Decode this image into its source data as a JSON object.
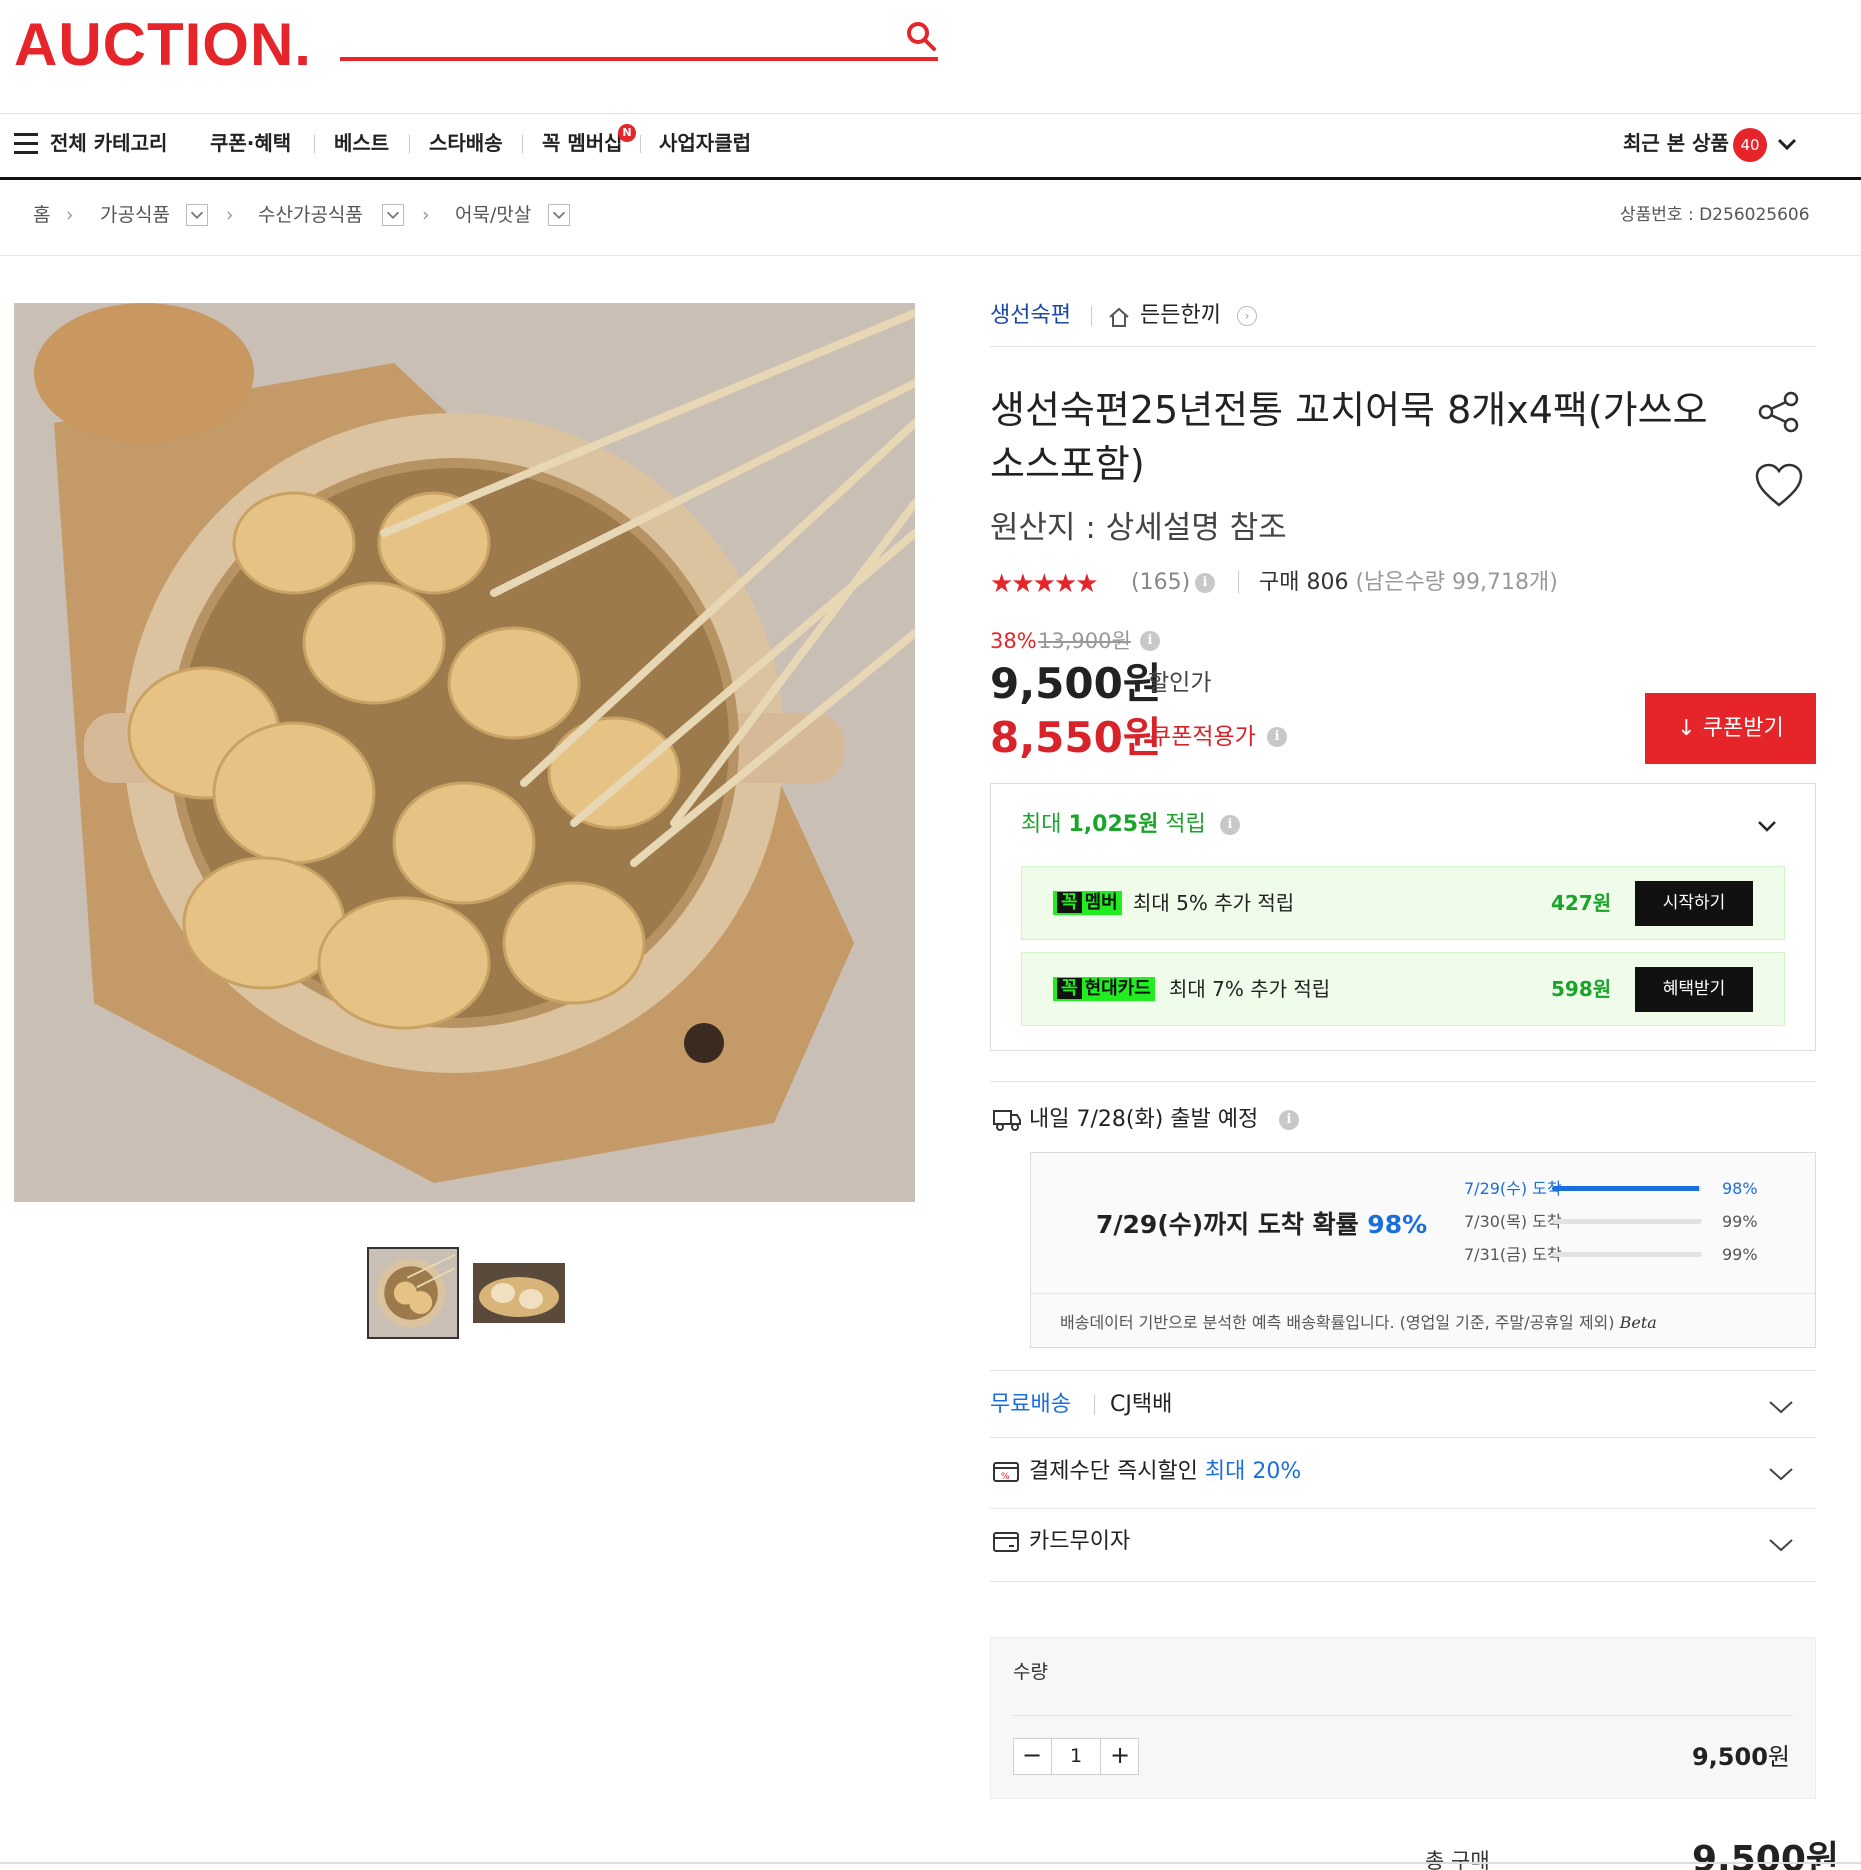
{
  "header": {
    "logo": "AUCTION.",
    "nav": {
      "all_categories": "전체 카테고리",
      "items": [
        "쿠폰·혜택",
        "베스트",
        "스타배송",
        "꼭 멤버십",
        "사업자클럽"
      ],
      "membership_badge": "N",
      "recent_label": "최근 본 상품",
      "recent_count": "40"
    }
  },
  "breadcrumb": {
    "items": [
      "홈",
      "가공식품",
      "수산가공식품",
      "어묵/맛살"
    ],
    "product_no": "상품번호 : D256025606"
  },
  "product": {
    "seller": "생선숙편",
    "store": "든든한끼",
    "title": "생선숙편25년전통 꼬치어묵 8개x4팩(가쓰오소스포함)",
    "origin": "원산지 : 상세설명 참조",
    "rating_stars": "★★★★★",
    "review_count": "(165)",
    "purchase_label": "구매 806",
    "remaining": "(남은수량 99,718개)",
    "discount_rate": "38%",
    "original_price": "13,900원",
    "sale_price": "9,500원",
    "sale_label": "할인가",
    "coupon_price": "8,550원",
    "coupon_label": "쿠폰적용가",
    "coupon_button": "↓ 쿠폰받기"
  },
  "points": {
    "title_prefix": "최대 ",
    "title_amount": "1,025원",
    "title_suffix": " 적립",
    "benefits": [
      {
        "logo_a": "꼭",
        "logo_b": "멤버",
        "text": "최대 5% 추가 적립",
        "amount": "427원",
        "button": "시작하기"
      },
      {
        "logo_a": "꼭",
        "logo_b": "현대카드",
        "text": "최대 7% 추가 적립",
        "amount": "598원",
        "button": "혜택받기"
      }
    ]
  },
  "shipping": {
    "departure": "내일 7/28(화) 출발 예정",
    "arrival_main": "7/29(수)까지 도착 확률",
    "arrival_pct": "98%",
    "rows": [
      {
        "label": "7/29(수) 도착",
        "pct": "98%",
        "fill": 0.98,
        "highlight": true
      },
      {
        "label": "7/30(목) 도착",
        "pct": "99%",
        "fill": 0.0,
        "highlight": false
      },
      {
        "label": "7/31(금) 도착",
        "pct": "99%",
        "fill": 0.0,
        "highlight": false
      }
    ],
    "note": "배송데이터 기반으로 분석한 예측 배송확률입니다. (영업일 기준, 주말/공휴일 제외)",
    "beta": "Beta",
    "free_shipping": "무료배송",
    "courier": "CJ택배"
  },
  "payment": {
    "instant_label": "결제수단 즉시할인",
    "instant_value": "최대 20%",
    "installment": "카드무이자"
  },
  "quantity": {
    "label": "수량",
    "value": "1",
    "price_num": "9,500",
    "price_unit": "원",
    "total_label": "총 구매",
    "total_price": "9,500원"
  },
  "colors": {
    "brand": "#e5252a",
    "points": "#1aa52a",
    "link": "#1b6fdd"
  }
}
